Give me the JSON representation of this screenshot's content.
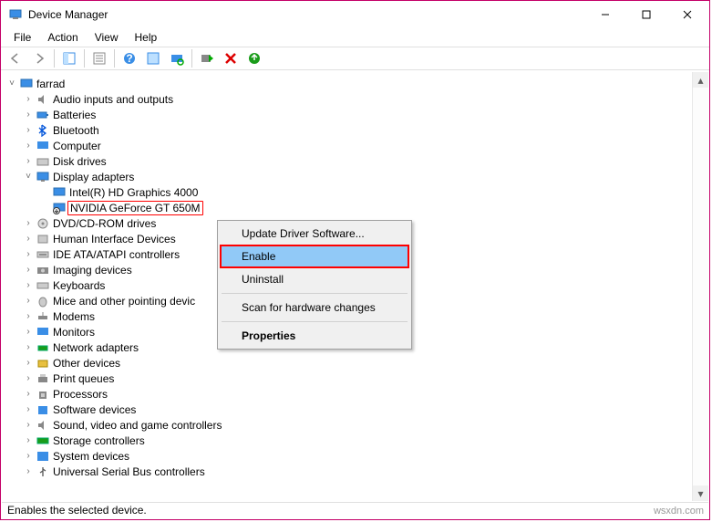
{
  "window": {
    "title": "Device Manager"
  },
  "menu": {
    "file": "File",
    "action": "Action",
    "view": "View",
    "help": "Help"
  },
  "tree": {
    "root": "farrad",
    "audio": "Audio inputs and outputs",
    "batteries": "Batteries",
    "bluetooth": "Bluetooth",
    "computer": "Computer",
    "disk": "Disk drives",
    "display": "Display adapters",
    "display_children": {
      "intel": "Intel(R) HD Graphics 4000",
      "nvidia": "NVIDIA GeForce GT 650M"
    },
    "dvd": "DVD/CD-ROM drives",
    "hid": "Human Interface Devices",
    "ide": "IDE ATA/ATAPI controllers",
    "imaging": "Imaging devices",
    "keyboards": "Keyboards",
    "mice": "Mice and other pointing devic",
    "modems": "Modems",
    "monitors": "Monitors",
    "network": "Network adapters",
    "other": "Other devices",
    "print": "Print queues",
    "processors": "Processors",
    "software": "Software devices",
    "sound": "Sound, video and game controllers",
    "storage": "Storage controllers",
    "system": "System devices",
    "usb": "Universal Serial Bus controllers"
  },
  "context_menu": {
    "update": "Update Driver Software...",
    "enable": "Enable",
    "uninstall": "Uninstall",
    "scan": "Scan for hardware changes",
    "properties": "Properties"
  },
  "status": "Enables the selected device.",
  "watermark": "wsxdn.com"
}
